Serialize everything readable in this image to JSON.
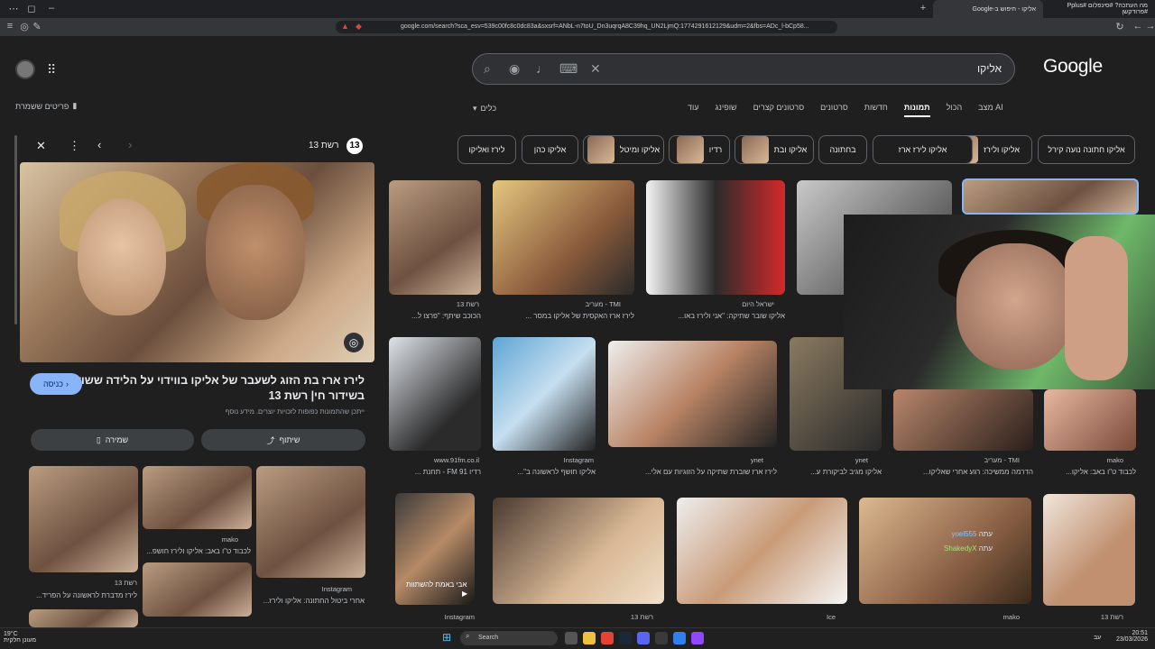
{
  "browser": {
    "tabs": [
      {
        "title": "מה העתכה? #סינפלום #Pplus #פרודקשן"
      },
      {
        "title": "אליקו - חיפוש ב-Google"
      }
    ],
    "url": "google.com/search?sca_esv=539c00fc8c0dc83a&sxsrf=ANbL-n7toU_Dn3uqrqA8C39hq_UN2LjmQ:1774291612129&udm=2&fbs=ADc_l-bCp58..."
  },
  "google": {
    "logo": "Google",
    "query": "אליקו",
    "saved_items": "פריטים ששמרת",
    "tools": "כלים",
    "tabs": [
      "מצב AI",
      "הכול",
      "תמונות",
      "חדשות",
      "סרטונים",
      "סרטונים קצרים",
      "שופינג",
      "עוד"
    ],
    "active_tab": "תמונות",
    "chips": [
      "אליקו חתונה נועה קירל",
      "אליקו ולירז",
      "אליקו לירז ארז",
      "בחתונה",
      "אליקו ובת",
      "רדיו",
      "אליקו ומיטל",
      "אליקו כהן",
      "לירז ואליקו"
    ]
  },
  "panel": {
    "source": "רשת 13",
    "title": "לירז ארז בת הזוג לשעבר של אליקו בווידוי על הלידה ששודרה בשידור חי| רשת 13",
    "subtitle": "ייתכן שהתמונות כפופות לזכויות יוצרים.  מידע נוסף",
    "visit": "כניסה",
    "share": "שיתוף",
    "save": "שמירה",
    "related": [
      {
        "source": "רשת 13",
        "caption": "לירז מדברת לראשונה על הפריד..."
      },
      {
        "source": "mako",
        "caption": "לכבוד ט\"ו באב: אליקו ולירז חושפ..."
      },
      {
        "source": "Instagram",
        "caption": "אחרי ביטול החתונה: אליקו ולירז..."
      }
    ]
  },
  "results": [
    {
      "source": "רשת 13",
      "caption": "הכוכב שיתף: \"פרצו ל..."
    },
    {
      "source": "TMI - מעריב",
      "caption": "לירז ארז האקסית של אליקו במסר ..."
    },
    {
      "source": "ישראל היום",
      "caption": "אליקו שובר שתיקה: \"אני ולירז באו..."
    },
    {
      "source": "www.91fm.co.il",
      "caption": "רדיו FM 91 - תחנת ..."
    },
    {
      "source": "Instagram",
      "caption": "אליקו חושף לראשונה ב\"..."
    },
    {
      "source": "ynet",
      "caption": "לירז ארז שוברת שתיקה על הזוגיות עם אלי..."
    },
    {
      "source": "ynet",
      "caption": "אליקו מגיב לביקורת ע..."
    },
    {
      "source": "TMI - מעריב",
      "caption": "הדרמה ממשיכה: רגע אחרי שאליקו..."
    },
    {
      "source": "mako",
      "caption": "לכבוד ט\"ו באב: אליקו..."
    },
    {
      "source": "Instagram",
      "caption": ""
    },
    {
      "source": "רשת 13",
      "caption": ""
    },
    {
      "source": "Ice",
      "caption": ""
    },
    {
      "source": "mako",
      "caption": ""
    },
    {
      "source": "רשת 13",
      "caption": ""
    }
  ],
  "overlay_labels": [
    "אבי באמת להשתוות"
  ],
  "chat": [
    {
      "user": "yoel555",
      "text": "עתה"
    },
    {
      "user": "ShakedyX",
      "text": "עתה"
    }
  ],
  "taskbar": {
    "weather": "19°C",
    "weather_desc": "מעונן חלקית",
    "search": "Search",
    "time": "20:51",
    "date": "23/03/2026",
    "lang": "עב"
  },
  "colors": {
    "accent": "#8ab4f8",
    "bg": "#1f1f1f"
  }
}
